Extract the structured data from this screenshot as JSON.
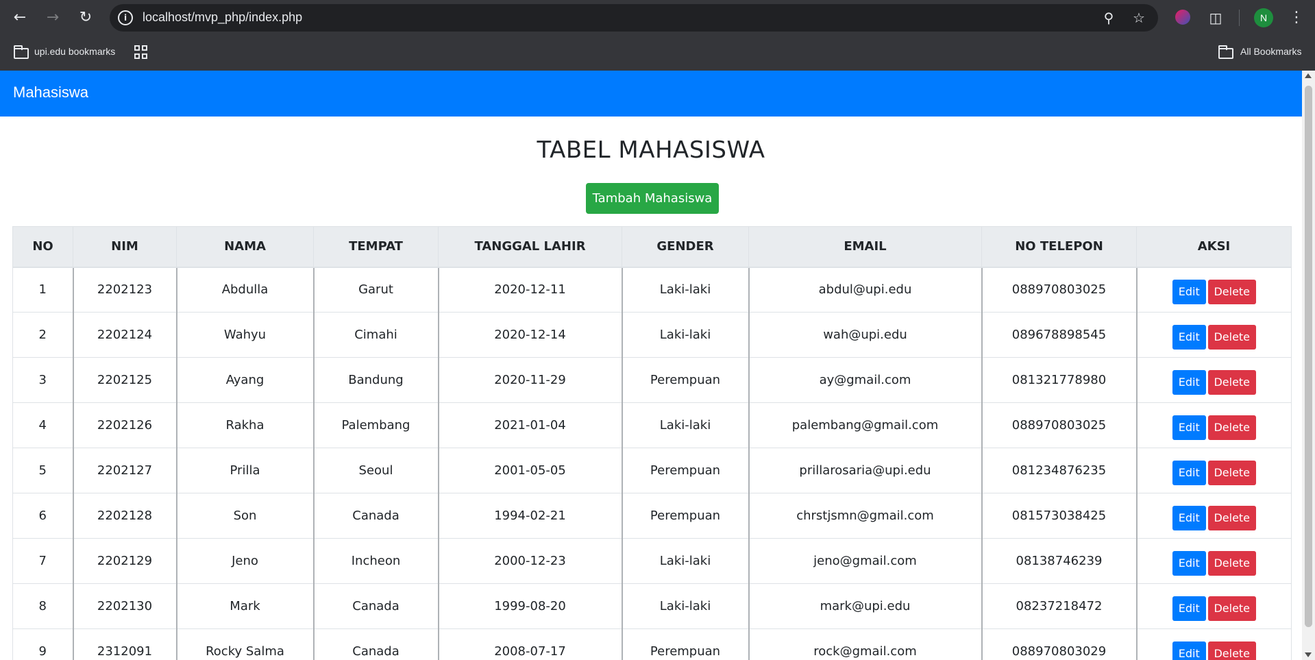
{
  "browser": {
    "url": "localhost/mvp_php/index.php",
    "bookmarks": [
      {
        "label": "upi.edu bookmarks"
      },
      {
        "label": "All Bookmarks"
      }
    ],
    "profile_initial": "N"
  },
  "navbar": {
    "brand": "Mahasiswa"
  },
  "main": {
    "title": "TABEL MAHASISWA",
    "add_button": "Tambah Mahasiswa"
  },
  "table": {
    "headers": [
      "NO",
      "NIM",
      "NAMA",
      "TEMPAT",
      "TANGGAL LAHIR",
      "GENDER",
      "EMAIL",
      "NO TELEPON",
      "AKSI"
    ],
    "rows": [
      {
        "no": "1",
        "nim": "2202123",
        "nama": "Abdulla",
        "tempat": "Garut",
        "tanggal": "2020-12-11",
        "gender": "Laki-laki",
        "email": "abdul@upi.edu",
        "telepon": "088970803025"
      },
      {
        "no": "2",
        "nim": "2202124",
        "nama": "Wahyu",
        "tempat": "Cimahi",
        "tanggal": "2020-12-14",
        "gender": "Laki-laki",
        "email": "wah@upi.edu",
        "telepon": "089678898545"
      },
      {
        "no": "3",
        "nim": "2202125",
        "nama": "Ayang",
        "tempat": "Bandung",
        "tanggal": "2020-11-29",
        "gender": "Perempuan",
        "email": "ay@gmail.com",
        "telepon": "081321778980"
      },
      {
        "no": "4",
        "nim": "2202126",
        "nama": "Rakha",
        "tempat": "Palembang",
        "tanggal": "2021-01-04",
        "gender": "Laki-laki",
        "email": "palembang@gmail.com",
        "telepon": "088970803025"
      },
      {
        "no": "5",
        "nim": "2202127",
        "nama": "Prilla",
        "tempat": "Seoul",
        "tanggal": "2001-05-05",
        "gender": "Perempuan",
        "email": "prillarosaria@upi.edu",
        "telepon": "081234876235"
      },
      {
        "no": "6",
        "nim": "2202128",
        "nama": "Son",
        "tempat": "Canada",
        "tanggal": "1994-02-21",
        "gender": "Perempuan",
        "email": "chrstjsmn@gmail.com",
        "telepon": "081573038425"
      },
      {
        "no": "7",
        "nim": "2202129",
        "nama": "Jeno",
        "tempat": "Incheon",
        "tanggal": "2000-12-23",
        "gender": "Laki-laki",
        "email": "jeno@gmail.com",
        "telepon": "08138746239"
      },
      {
        "no": "8",
        "nim": "2202130",
        "nama": "Mark",
        "tempat": "Canada",
        "tanggal": "1999-08-20",
        "gender": "Laki-laki",
        "email": "mark@upi.edu",
        "telepon": "08237218472"
      },
      {
        "no": "9",
        "nim": "2312091",
        "nama": "Rocky Salma",
        "tempat": "Canada",
        "tanggal": "2008-07-17",
        "gender": "Perempuan",
        "email": "rock@gmail.com",
        "telepon": "088970803029"
      }
    ],
    "edit_label": "Edit",
    "delete_label": "Delete"
  },
  "colors": {
    "navbar": "#007bff",
    "success": "#28a745",
    "primary": "#007bff",
    "danger": "#dc3545",
    "header_bg": "#e9ecef"
  }
}
